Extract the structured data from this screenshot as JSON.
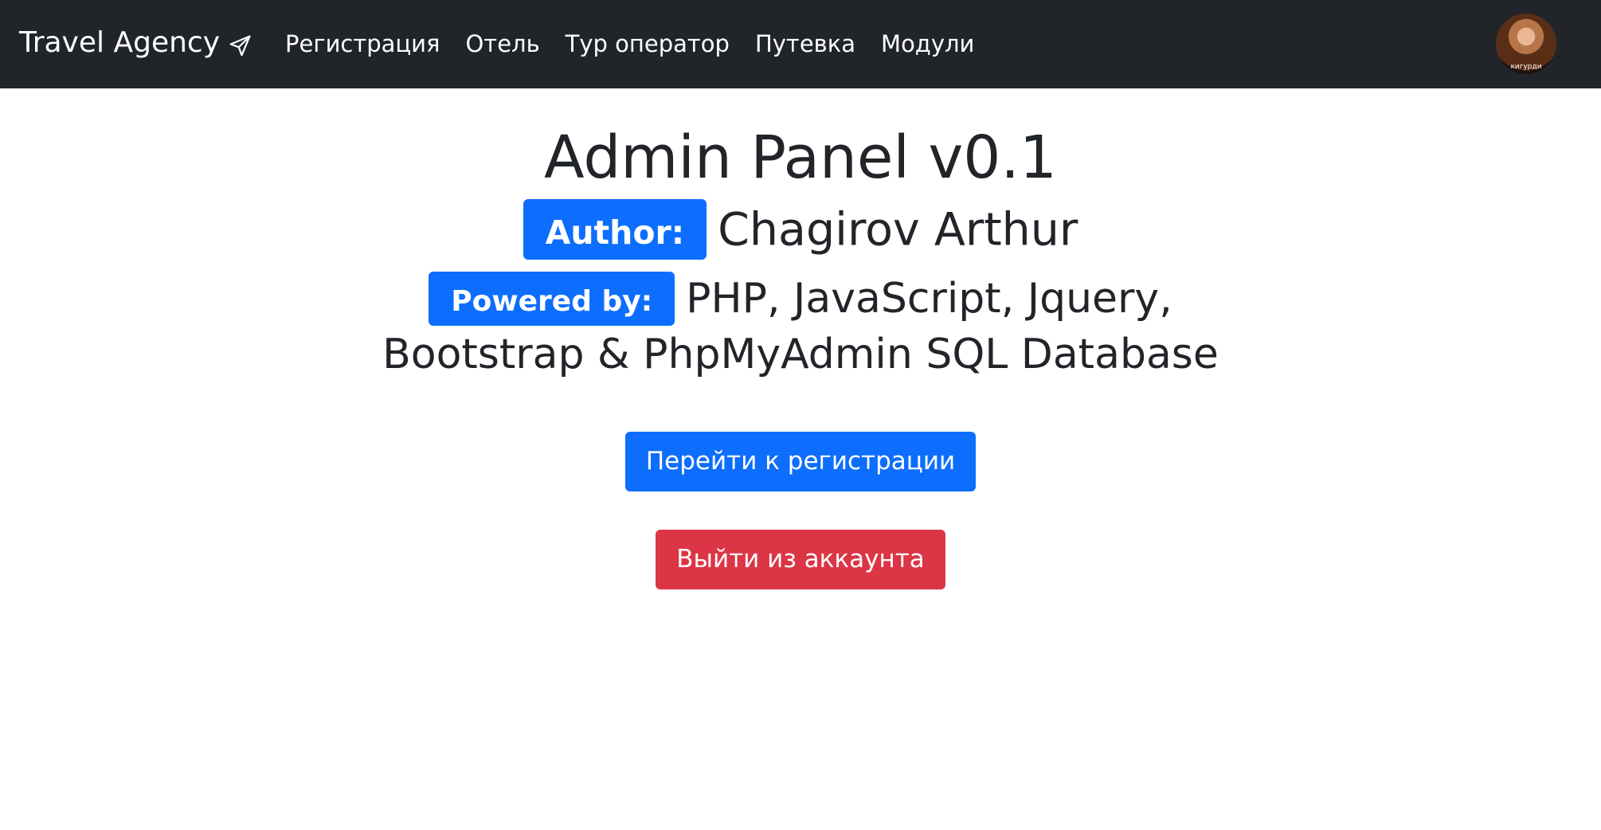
{
  "navbar": {
    "brand": "Travel Agency",
    "brand_icon": "send-icon",
    "links": [
      "Регистрация",
      "Отель",
      "Тур оператор",
      "Путевка",
      "Модули"
    ],
    "avatar_caption": "кигурди"
  },
  "main": {
    "title": "Admin Panel v0.1",
    "author_badge": "Author:",
    "author_name": "Chagirov Arthur",
    "powered_badge": "Powered by:",
    "powered_text_1": "PHP, JavaScript, Jquery,",
    "powered_text_2": "Bootstrap & PhpMyAdmin SQL Database",
    "register_button": "Перейти к регистрации",
    "logout_button": "Выйти из аккаунта"
  },
  "colors": {
    "navbar_bg": "#212529",
    "primary": "#0d6efd",
    "danger": "#dc3545",
    "text": "#212529"
  }
}
